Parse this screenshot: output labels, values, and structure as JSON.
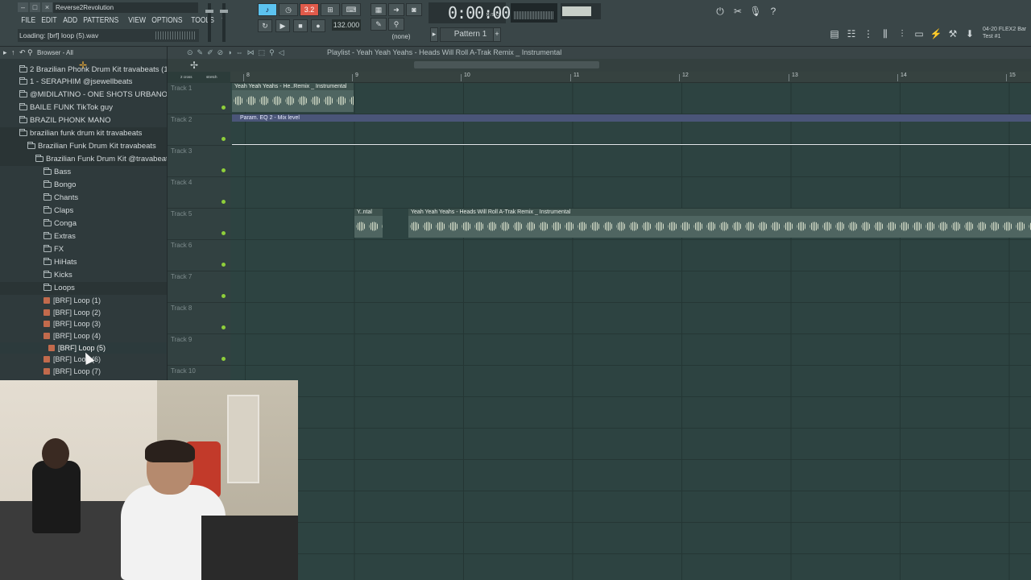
{
  "window": {
    "title": "Reverse2Revolution",
    "loading_text": "Loading: [brf] loop (5).wav"
  },
  "menu": [
    "FILE",
    "EDIT",
    "ADD",
    "PATTERNS",
    "VIEW",
    "OPTIONS",
    "TOOLS",
    "?"
  ],
  "transport": {
    "song_mode_label": "3.2",
    "tempo": "132.000",
    "time": "0:00:00",
    "time_unit": "M:S:CS",
    "none_label": "(none)",
    "pattern": "Pattern 1"
  },
  "plugin_info": {
    "line1": "04-20 FLEX2 Bar",
    "line2": "Test #1"
  },
  "browser": {
    "header": "Browser - All",
    "items": [
      {
        "label": "2 Brazilian Phonk Drum Kit travabeats (1)",
        "level": 1
      },
      {
        "label": "1 - SERAPHIM @jsewellbeats",
        "level": 1
      },
      {
        "label": "@MIDILATINO - ONE SHOTS URBANOS VOL. 2",
        "level": 1
      },
      {
        "label": "BAILE FUNK TikTok guy",
        "level": 1
      },
      {
        "label": "BRAZIL PHONK MANO",
        "level": 1
      },
      {
        "label": "brazilian funk drum kit travabeats",
        "level": 1
      },
      {
        "label": "Brazilian Funk Drum Kit travabeats",
        "level": 2
      },
      {
        "label": "Brazilian Funk Drum Kit @travabeats",
        "level": 3
      },
      {
        "label": "Bass",
        "level": 4
      },
      {
        "label": "Bongo",
        "level": 4
      },
      {
        "label": "Chants",
        "level": 4
      },
      {
        "label": "Claps",
        "level": 4
      },
      {
        "label": "Conga",
        "level": 4
      },
      {
        "label": "Extras",
        "level": 4
      },
      {
        "label": "FX",
        "level": 4
      },
      {
        "label": "HiHats",
        "level": 4
      },
      {
        "label": "Kicks",
        "level": 4
      },
      {
        "label": "Loops",
        "level": 4
      }
    ],
    "files": [
      "[BRF] Loop (1)",
      "[BRF] Loop (2)",
      "[BRF] Loop (3)",
      "[BRF] Loop (4)",
      "[BRF] Loop (5)",
      "[BRF] Loop (6)",
      "[BRF] Loop (7)"
    ]
  },
  "playlist": {
    "title": "Playlist - Yeah Yeah Yeahs - Heads Will Roll A-Trak Remix _ Instrumental",
    "toggle_1": "2 cross",
    "toggle_2": "stretch",
    "ruler": [
      "9",
      "10",
      "11",
      "12",
      "13",
      "14",
      "15"
    ],
    "tracks": [
      "Track 1",
      "Track 2",
      "Track 3",
      "Track 4",
      "Track 5",
      "Track 6",
      "Track 7",
      "Track 8",
      "Track 9",
      "Track 10"
    ],
    "clips": {
      "track1": "Yeah Yeah Yeahs - He..Remix _ Instrumental",
      "track2_auto": "Param. EQ 2 - Mix level",
      "track5a": "Y..ntal",
      "track5b": "Yeah Yeah Yeahs - Heads Will Roll A-Trak Remix _ Instrumental"
    }
  },
  "colors": {
    "accent": "#5cc3f0",
    "track_bg": "#2d4341",
    "waveform": "#d4dcc8",
    "automation": "#4a5578"
  }
}
